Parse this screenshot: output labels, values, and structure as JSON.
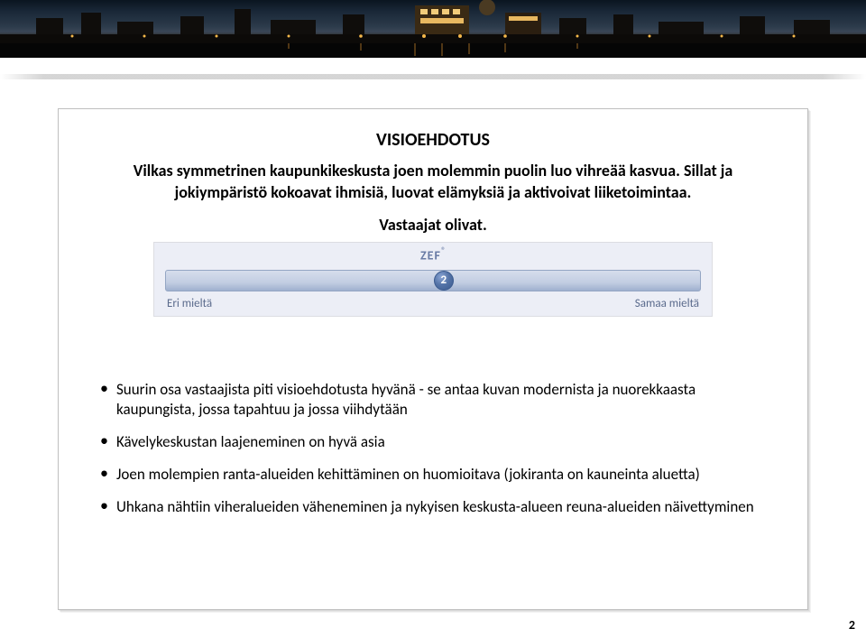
{
  "banner": {
    "alt": "Night cityscape silhouette header image"
  },
  "panel": {
    "title": "VISIOEHDOTUS",
    "subtitle": "Vilkas symmetrinen kaupunkikeskusta joen molemmin puolin luo vihreää kasvua. Sillat ja jokiympäristö kokoavat ihmisiä, luovat elämyksiä ja aktivoivat liiketoimintaa.",
    "subheading": "Vastaajat olivat."
  },
  "zef": {
    "brand": "ZEF",
    "brand_sup": "®",
    "left_label": "Eri mieltä",
    "right_label": "Samaa mieltä",
    "marker_label": "2",
    "marker_position_pct": 52
  },
  "bullets": [
    "Suurin osa vastaajista piti visioehdotusta hyvänä - se antaa kuvan modernista ja nuorekkaasta kaupungista, jossa tapahtuu ja jossa viihdytään",
    "Kävelykeskustan laajeneminen on hyvä asia",
    "Joen molempien ranta-alueiden kehittäminen on huomioitava (jokiranta on kauneinta aluetta)",
    "Uhkana nähtiin viheralueiden väheneminen ja nykyisen keskusta-alueen reuna-alueiden näivettyminen"
  ],
  "page_number": "2"
}
